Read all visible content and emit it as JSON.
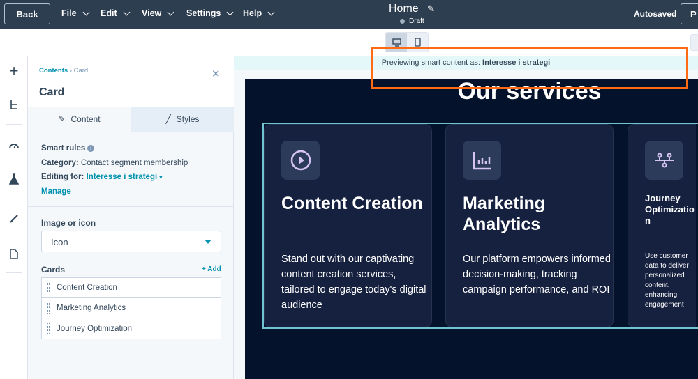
{
  "topbar": {
    "back": "Back",
    "menus": [
      "File",
      "Edit",
      "View",
      "Settings",
      "Help"
    ],
    "title": "Home",
    "status": "Draft",
    "autosaved": "Autosaved",
    "publish_partial": "P"
  },
  "panel": {
    "breadcrumb": {
      "parent": "Contents",
      "current": "Card"
    },
    "title": "Card",
    "tabs": [
      {
        "label": "Content",
        "icon": "pencil-icon"
      },
      {
        "label": "Styles",
        "icon": "brush-icon"
      }
    ],
    "smart_rules": {
      "label": "Smart rules",
      "category_label": "Category:",
      "category_value": "Contact segment membership",
      "editing_label": "Editing for:",
      "editing_value": "Interesse i strategi",
      "manage": "Manage"
    },
    "image_or_icon": {
      "label": "Image or icon",
      "value": "Icon"
    },
    "cards": {
      "label": "Cards",
      "add": "+ Add",
      "items": [
        "Content Creation",
        "Marketing Analytics",
        "Journey Optimization"
      ]
    }
  },
  "preview": {
    "banner_prefix": "Previewing smart content as:",
    "banner_value": "Interesse i strategi",
    "heading": "Our services",
    "cards": [
      {
        "icon": "play-circle-icon",
        "title": "Content Creation",
        "body": "Stand out with our captivating content creation services, tailored to engage today's digital audience"
      },
      {
        "icon": "bar-chart-icon",
        "title": "Marketing Analytics",
        "body": "Our platform empowers informed decision-making, tracking campaign performance, and ROI"
      },
      {
        "icon": "journey-nodes-icon",
        "title": "Journey Optimization",
        "body": "Use customer data to deliver personalized content, enhancing engagement"
      }
    ]
  },
  "colors": {
    "topbar": "#2d3e50",
    "accent": "#0091ae",
    "canvas": "#04132b",
    "card": "#162140",
    "highlight": "#ff6a13",
    "icon": "#d6c4f5"
  }
}
